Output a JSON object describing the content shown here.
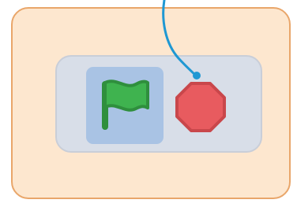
{
  "panel": {
    "background_color": "#fde7cf",
    "border_color": "#e9a66a"
  },
  "controls": {
    "background_color": "#d8dee8",
    "border_color": "#c9ced8",
    "flag_button": {
      "icon": "green-flag-icon",
      "selected": true,
      "color": "#3fb34f",
      "highlight_color": "#a9c3e4"
    },
    "stop_button": {
      "icon": "stop-sign-icon",
      "color": "#e85b5f",
      "outline_color": "#c9474b"
    }
  },
  "connector": {
    "color": "#1f98d3"
  }
}
